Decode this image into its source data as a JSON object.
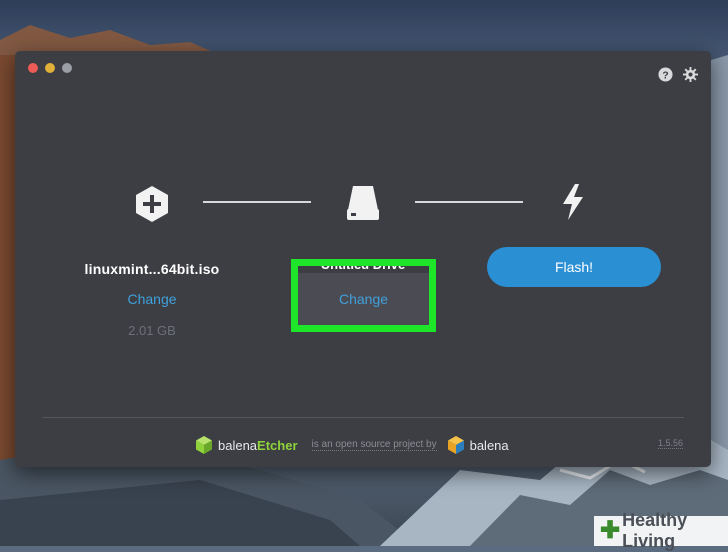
{
  "window": {
    "controls": [
      "close",
      "minimize",
      "zoom"
    ],
    "top_icons": [
      "help-icon",
      "gear-icon"
    ]
  },
  "steps": {
    "image": {
      "icon": "plus-hexagon-icon",
      "filename": "linuxmint...64bit.iso",
      "change_label": "Change",
      "size": "2.01 GB"
    },
    "drive": {
      "icon": "drive-icon",
      "name": "Untitled Drive",
      "change_label": "Change"
    },
    "flash": {
      "icon": "lightning-icon",
      "button_label": "Flash!"
    }
  },
  "footer": {
    "brand_prefix": "balena",
    "brand_suffix": "Etcher",
    "tagline": "is an open source project by",
    "company": "balena",
    "version": "1.5.56"
  },
  "overlay": {
    "highlight_color": "#1ee52a",
    "watermark": "Healthy Living"
  },
  "colors": {
    "window_bg": "#3d3e44",
    "accent_blue": "#2a8fd3",
    "link_blue": "#3fa0dc",
    "etcher_green": "#8ed33a"
  }
}
